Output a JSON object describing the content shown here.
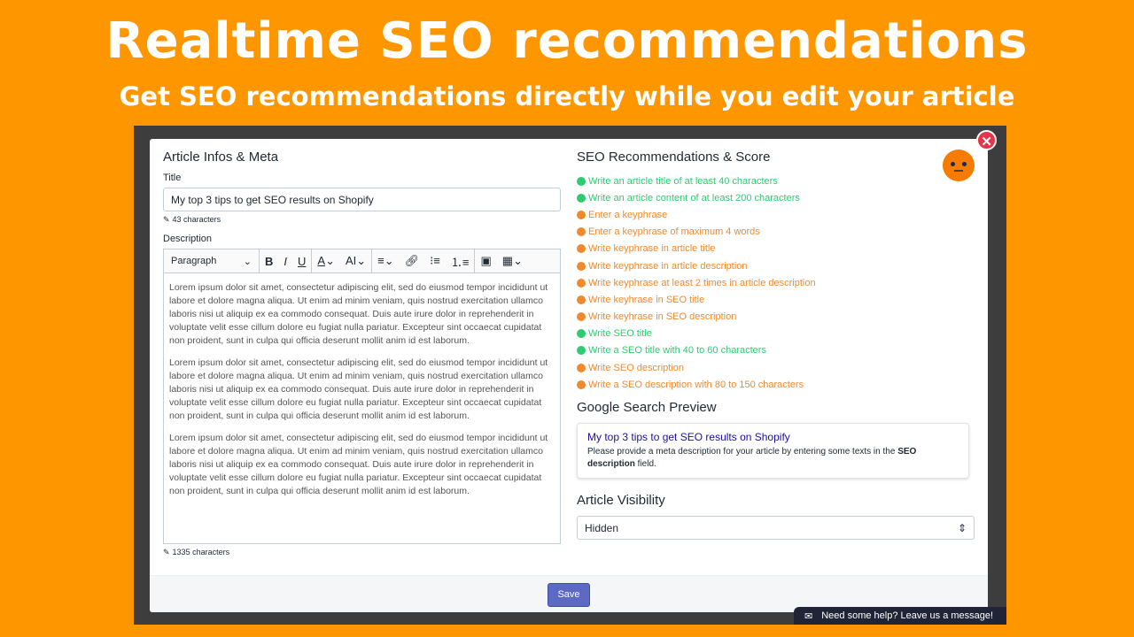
{
  "hero": {
    "title": "Realtime SEO recommendations",
    "subtitle": "Get SEO recommendations directly while you edit your article"
  },
  "left": {
    "heading": "Article Infos & Meta",
    "title_label": "Title",
    "title_value": "My top 3 tips to get SEO results on Shopify",
    "title_count": "43 characters",
    "description_label": "Description",
    "toolbar": {
      "paragraph": "Paragraph"
    },
    "paragraphs": [
      "Lorem ipsum dolor sit amet, consectetur adipiscing elit, sed do eiusmod tempor incididunt ut labore et dolore magna aliqua. Ut enim ad minim veniam, quis nostrud exercitation ullamco laboris nisi ut aliquip ex ea commodo consequat. Duis aute irure dolor in reprehenderit in voluptate velit esse cillum dolore eu fugiat nulla pariatur. Excepteur sint occaecat cupidatat non proident, sunt in culpa qui officia deserunt mollit anim id est laborum.",
      "Lorem ipsum dolor sit amet, consectetur adipiscing elit, sed do eiusmod tempor incididunt ut labore et dolore magna aliqua. Ut enim ad minim veniam, quis nostrud exercitation ullamco laboris nisi ut aliquip ex ea commodo consequat. Duis aute irure dolor in reprehenderit in voluptate velit esse cillum dolore eu fugiat nulla pariatur. Excepteur sint occaecat cupidatat non proident, sunt in culpa qui officia deserunt mollit anim id est laborum.",
      "Lorem ipsum dolor sit amet, consectetur adipiscing elit, sed do eiusmod tempor incididunt ut labore et dolore magna aliqua. Ut enim ad minim veniam, quis nostrud exercitation ullamco laboris nisi ut aliquip ex ea commodo consequat. Duis aute irure dolor in reprehenderit in voluptate velit esse cillum dolore eu fugiat nulla pariatur. Excepteur sint occaecat cupidatat non proident, sunt in culpa qui officia deserunt mollit anim id est laborum."
    ],
    "description_count": "1335 characters"
  },
  "right": {
    "heading": "SEO Recommendations & Score",
    "score_face": "neutral-face-icon",
    "colors": {
      "done": "#2ecc71",
      "todo": "#f08a2c"
    },
    "recommendations": [
      {
        "text": "Write an article title of at least 40 characters",
        "status": "done"
      },
      {
        "text": "Write an article content of at least 200 characters",
        "status": "done"
      },
      {
        "text": "Enter a keyphrase",
        "status": "todo"
      },
      {
        "text": "Enter a keyphrase of maximum 4 words",
        "status": "todo"
      },
      {
        "text": "Write keyphrase in article title",
        "status": "todo"
      },
      {
        "text": "Write keyphrase in article description",
        "status": "todo"
      },
      {
        "text": "Write keyphrase at least 2 times in article description",
        "status": "todo"
      },
      {
        "text": "Write keyhrase in SEO title",
        "status": "todo"
      },
      {
        "text": "Write keyhrase in SEO description",
        "status": "todo"
      },
      {
        "text": "Write SEO title",
        "status": "done"
      },
      {
        "text": "Write a SEO title with 40 to 60 characters",
        "status": "done"
      },
      {
        "text": "Write SEO description",
        "status": "todo"
      },
      {
        "text": "Write a SEO description with 80 to 150 characters",
        "status": "todo"
      }
    ],
    "preview_heading": "Google Search Preview",
    "preview_title": "My top 3 tips to get SEO results on Shopify",
    "preview_desc_a": "Please provide a meta description for your article by entering some texts in the ",
    "preview_desc_b": "SEO description",
    "preview_desc_c": " field.",
    "visibility_heading": "Article Visibility",
    "visibility_value": "Hidden"
  },
  "footer": {
    "save": "Save"
  },
  "help": {
    "text": "Need some help? Leave us a message!"
  }
}
